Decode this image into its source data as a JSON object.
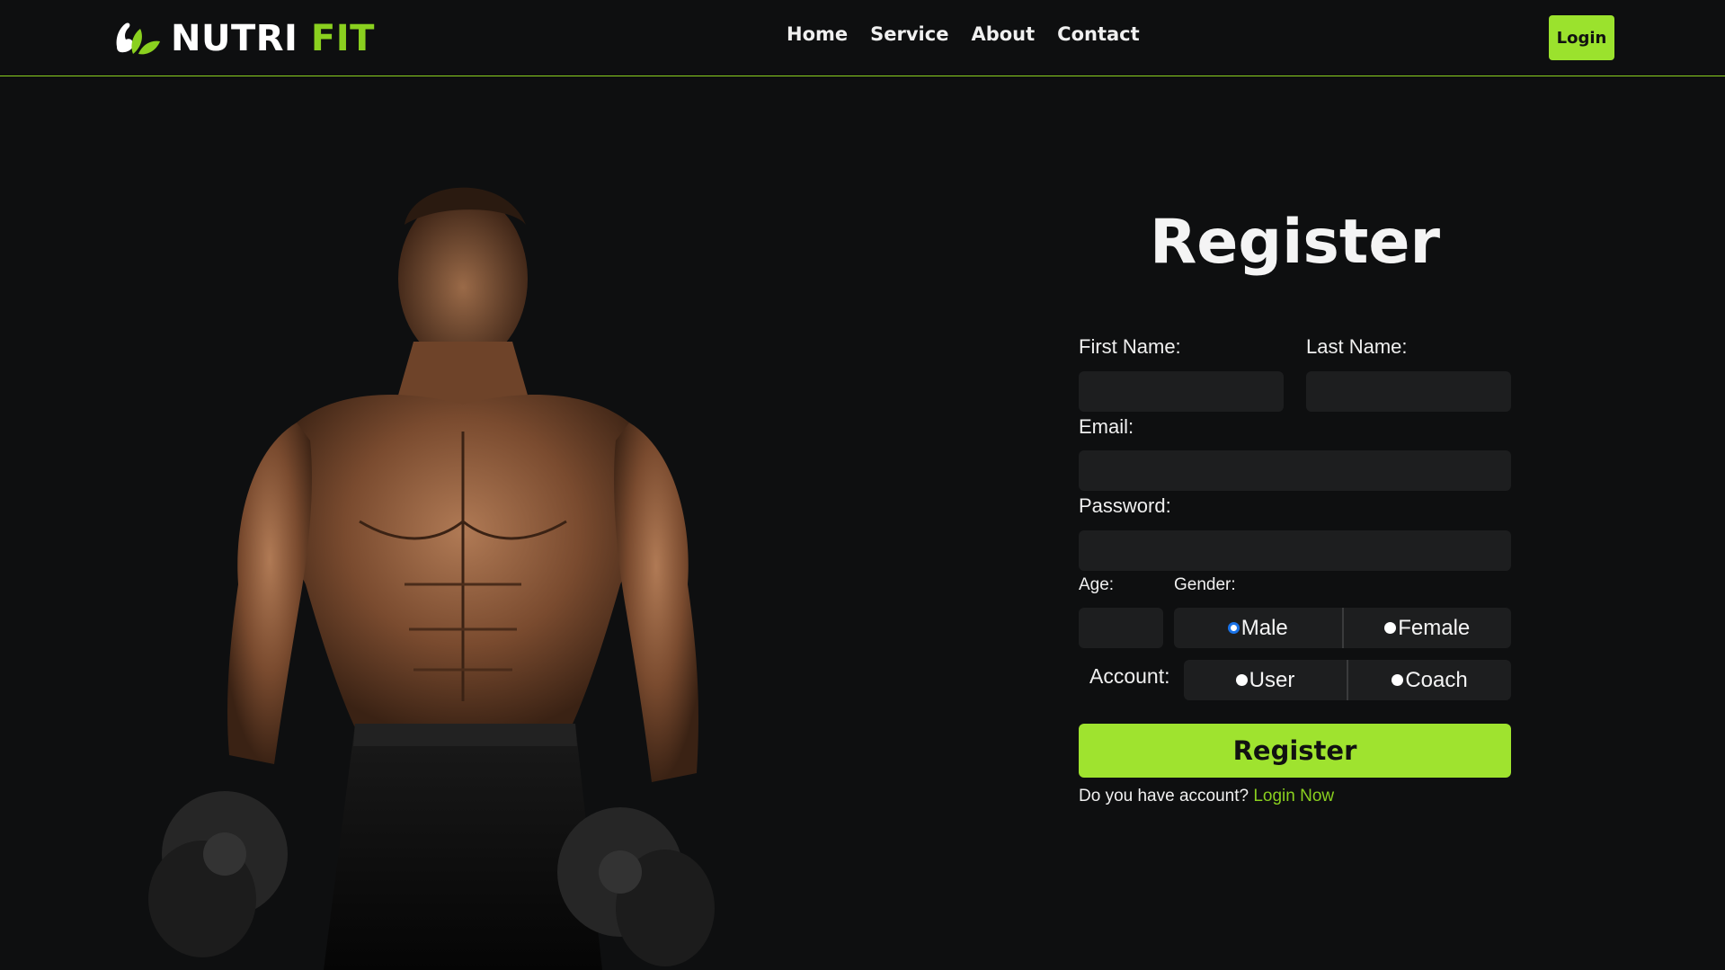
{
  "header": {
    "logo_word_1": "NUTRI",
    "logo_word_2": "FIT",
    "nav": [
      "Home",
      "Service",
      "About",
      "Contact"
    ],
    "login_label": "Login"
  },
  "form": {
    "title": "Register",
    "first_name_label": "First Name:",
    "last_name_label": "Last Name:",
    "email_label": "Email:",
    "password_label": "Password:",
    "age_label": "Age:",
    "gender_label": "Gender:",
    "gender_options": [
      "Male",
      "Female"
    ],
    "gender_selected": "Male",
    "account_label": "Account:",
    "account_options": [
      "User",
      "Coach"
    ],
    "register_label": "Register",
    "have_account_text": "Do you have account?",
    "login_now_label": "Login Now"
  },
  "colors": {
    "accent": "#8ad01f",
    "button": "#9fe32f",
    "background": "#0e0f10",
    "field": "#1d1e1f"
  }
}
